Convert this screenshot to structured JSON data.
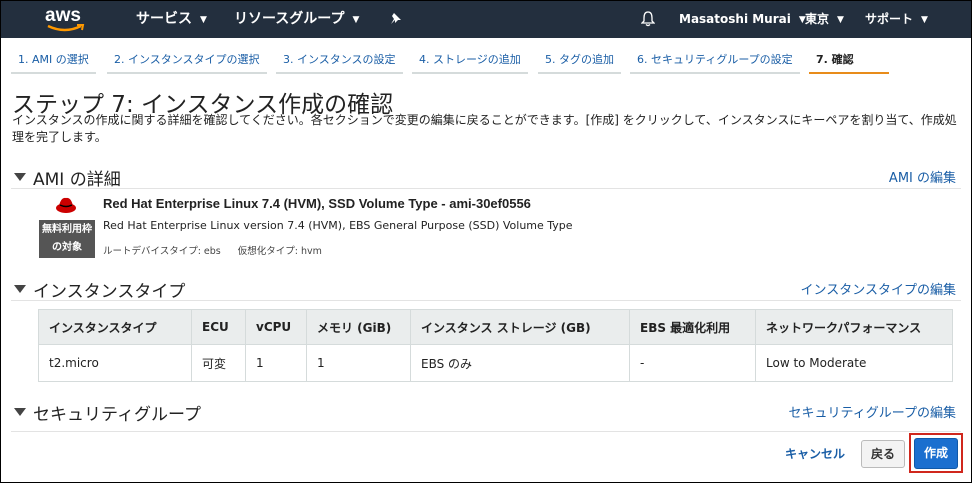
{
  "nav": {
    "logo": "aws",
    "services": "サービス",
    "resource_groups": "リソースグループ",
    "user": "Masatoshi Murai",
    "region": "東京",
    "support": "サポート"
  },
  "steps": [
    {
      "label": "1. AMI の選択"
    },
    {
      "label": "2. インスタンスタイプの選択"
    },
    {
      "label": "3. インスタンスの設定"
    },
    {
      "label": "4. ストレージの追加"
    },
    {
      "label": "5. タグの追加"
    },
    {
      "label": "6. セキュリティグループの設定"
    },
    {
      "label": "7. 確認"
    }
  ],
  "page": {
    "title": "ステップ 7: インスタンス作成の確認",
    "description": "インスタンスの作成に関する詳細を確認してください。各セクションで変更の編集に戻ることができます。[作成] をクリックして、インスタンスにキーペアを割り当て、作成処理を完了します。"
  },
  "ami": {
    "section_title": "AMI の詳細",
    "edit_link": "AMI の編集",
    "badge_line1": "無料利用枠",
    "badge_line2": "の対象",
    "name": "Red Hat Enterprise Linux 7.4 (HVM), SSD Volume Type - ami-30ef0556",
    "description": "Red Hat Enterprise Linux version 7.4 (HVM), EBS General Purpose (SSD) Volume Type",
    "root_device": "ルートデバイスタイプ: ebs",
    "virtualization": "仮想化タイプ: hvm"
  },
  "instance_type": {
    "section_title": "インスタンスタイプ",
    "edit_link": "インスタンスタイプの編集",
    "headers": [
      "インスタンスタイプ",
      "ECU",
      "vCPU",
      "メモリ (GiB)",
      "インスタンス ストレージ (GB)",
      "EBS 最適化利用",
      "ネットワークパフォーマンス"
    ],
    "row": [
      "t2.micro",
      "可変",
      "1",
      "1",
      "EBS のみ",
      "-",
      "Low to Moderate"
    ]
  },
  "security_group": {
    "section_title": "セキュリティグループ",
    "edit_link": "セキュリティグループの編集"
  },
  "footer": {
    "cancel": "キャンセル",
    "back": "戻る",
    "create": "作成"
  }
}
